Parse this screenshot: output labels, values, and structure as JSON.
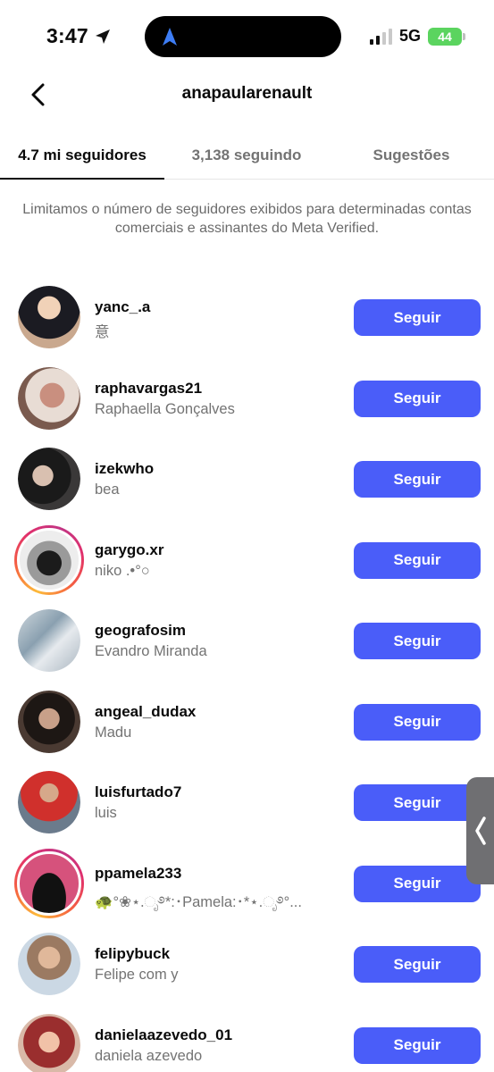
{
  "status_bar": {
    "time": "3:47",
    "network": "5G",
    "battery": "44"
  },
  "header": {
    "title": "anapaularenault"
  },
  "tabs": [
    {
      "label": "4.7 mi seguidores",
      "active": true
    },
    {
      "label": "3,138 seguindo",
      "active": false
    },
    {
      "label": "Sugestões",
      "active": false
    }
  ],
  "notice": "Limitamos o número de seguidores exibidos para determinadas contas comerciais e assinantes do Meta Verified.",
  "follow_label": "Seguir",
  "followers": [
    {
      "username": "yanc_.a",
      "fullname": "意",
      "ring": false
    },
    {
      "username": "raphavargas21",
      "fullname": "Raphaella Gonçalves",
      "ring": false
    },
    {
      "username": "izekwho",
      "fullname": "bea",
      "ring": false
    },
    {
      "username": "garygo.xr",
      "fullname": "niko .•°○",
      "ring": true
    },
    {
      "username": "geografosim",
      "fullname": "Evandro Miranda",
      "ring": false
    },
    {
      "username": "angeal_dudax",
      "fullname": "Madu",
      "ring": false
    },
    {
      "username": "luisfurtado7",
      "fullname": "luis",
      "ring": false
    },
    {
      "username": "ppamela233",
      "fullname": "🐢°❀⋆.ೃ࿔*:･Pamela:･*⋆.ೃ࿔°...",
      "ring": true
    },
    {
      "username": "felipybuck",
      "fullname": "Felipe com y",
      "ring": false
    },
    {
      "username": "danielaazevedo_01",
      "fullname": "daniela azevedo",
      "ring": false
    }
  ],
  "colors": {
    "accent": "#4a5df9",
    "story_ring": "#e1306c"
  }
}
